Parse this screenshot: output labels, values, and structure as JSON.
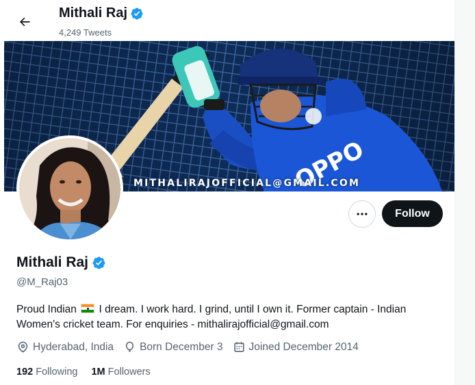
{
  "header": {
    "back_icon": "arrow-left-icon",
    "name": "Mithali Raj",
    "tweet_count": "4,249 Tweets"
  },
  "banner": {
    "email_text": "MITHALIRAJOFFICIAL@GMAIL.COM",
    "jersey_text": "OPPO"
  },
  "actions": {
    "more_icon": "more-dots-icon",
    "follow_label": "Follow"
  },
  "profile": {
    "name": "Mithali Raj",
    "verified_icon": "verified-badge-icon",
    "handle": "@M_Raj03",
    "bio_before_flag": "Proud Indian",
    "flag_icon": "india-flag-icon",
    "bio_after_flag": " I dream. I work hard. I grind, until I own it. Former captain - Indian Women's cricket team. For enquiries - mithalirajofficial@gmail.com",
    "location": "Hyderabad, India",
    "birthday": "Born December 3",
    "joined": "Joined December 2014",
    "following_count": "192",
    "following_label": "Following",
    "followers_count": "1M",
    "followers_label": "Followers"
  },
  "colors": {
    "verified": "#1d9bf0",
    "follow_bg": "#0f1419",
    "secondary_text": "#536471"
  }
}
